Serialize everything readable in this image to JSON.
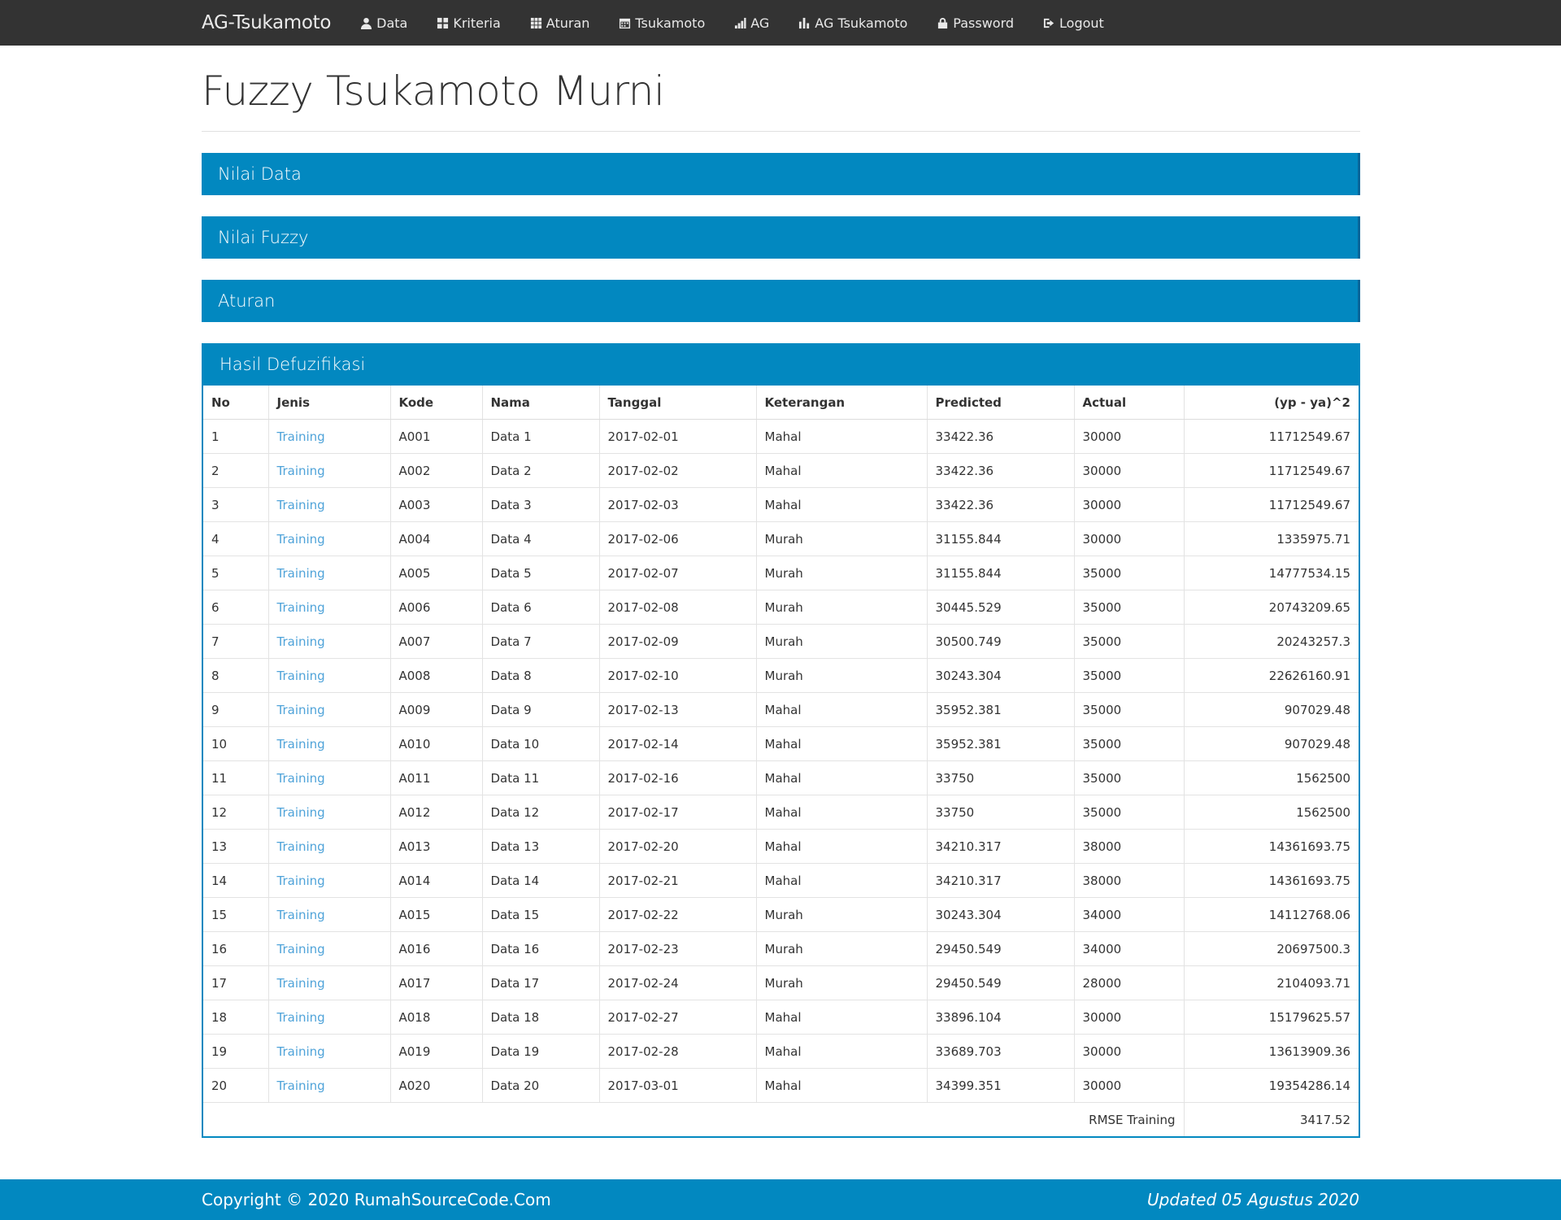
{
  "nav": {
    "brand": "AG-Tsukamoto",
    "items": [
      {
        "label": "Data",
        "icon": "user-icon"
      },
      {
        "label": "Kriteria",
        "icon": "grid-icon"
      },
      {
        "label": "Aturan",
        "icon": "th-icon"
      },
      {
        "label": "Tsukamoto",
        "icon": "calendar-icon"
      },
      {
        "label": "AG",
        "icon": "signal-icon"
      },
      {
        "label": "AG Tsukamoto",
        "icon": "stats-icon"
      },
      {
        "label": "Password",
        "icon": "lock-icon"
      },
      {
        "label": "Logout",
        "icon": "logout-icon"
      }
    ]
  },
  "page": {
    "title": "Fuzzy Tsukamoto Murni"
  },
  "panels": [
    {
      "title": "Nilai Data"
    },
    {
      "title": "Nilai Fuzzy"
    },
    {
      "title": "Aturan"
    }
  ],
  "result": {
    "title": "Hasil Defuzifikasi",
    "headers": [
      "No",
      "Jenis",
      "Kode",
      "Nama",
      "Tanggal",
      "Keterangan",
      "Predicted",
      "Actual",
      "(yp - ya)^2"
    ],
    "rows": [
      [
        "1",
        "Training",
        "A001",
        "Data 1",
        "2017-02-01",
        "Mahal",
        "33422.36",
        "30000",
        "11712549.67"
      ],
      [
        "2",
        "Training",
        "A002",
        "Data 2",
        "2017-02-02",
        "Mahal",
        "33422.36",
        "30000",
        "11712549.67"
      ],
      [
        "3",
        "Training",
        "A003",
        "Data 3",
        "2017-02-03",
        "Mahal",
        "33422.36",
        "30000",
        "11712549.67"
      ],
      [
        "4",
        "Training",
        "A004",
        "Data 4",
        "2017-02-06",
        "Murah",
        "31155.844",
        "30000",
        "1335975.71"
      ],
      [
        "5",
        "Training",
        "A005",
        "Data 5",
        "2017-02-07",
        "Murah",
        "31155.844",
        "35000",
        "14777534.15"
      ],
      [
        "6",
        "Training",
        "A006",
        "Data 6",
        "2017-02-08",
        "Murah",
        "30445.529",
        "35000",
        "20743209.65"
      ],
      [
        "7",
        "Training",
        "A007",
        "Data 7",
        "2017-02-09",
        "Murah",
        "30500.749",
        "35000",
        "20243257.3"
      ],
      [
        "8",
        "Training",
        "A008",
        "Data 8",
        "2017-02-10",
        "Murah",
        "30243.304",
        "35000",
        "22626160.91"
      ],
      [
        "9",
        "Training",
        "A009",
        "Data 9",
        "2017-02-13",
        "Mahal",
        "35952.381",
        "35000",
        "907029.48"
      ],
      [
        "10",
        "Training",
        "A010",
        "Data 10",
        "2017-02-14",
        "Mahal",
        "35952.381",
        "35000",
        "907029.48"
      ],
      [
        "11",
        "Training",
        "A011",
        "Data 11",
        "2017-02-16",
        "Mahal",
        "33750",
        "35000",
        "1562500"
      ],
      [
        "12",
        "Training",
        "A012",
        "Data 12",
        "2017-02-17",
        "Mahal",
        "33750",
        "35000",
        "1562500"
      ],
      [
        "13",
        "Training",
        "A013",
        "Data 13",
        "2017-02-20",
        "Mahal",
        "34210.317",
        "38000",
        "14361693.75"
      ],
      [
        "14",
        "Training",
        "A014",
        "Data 14",
        "2017-02-21",
        "Mahal",
        "34210.317",
        "38000",
        "14361693.75"
      ],
      [
        "15",
        "Training",
        "A015",
        "Data 15",
        "2017-02-22",
        "Murah",
        "30243.304",
        "34000",
        "14112768.06"
      ],
      [
        "16",
        "Training",
        "A016",
        "Data 16",
        "2017-02-23",
        "Murah",
        "29450.549",
        "34000",
        "20697500.3"
      ],
      [
        "17",
        "Training",
        "A017",
        "Data 17",
        "2017-02-24",
        "Murah",
        "29450.549",
        "28000",
        "2104093.71"
      ],
      [
        "18",
        "Training",
        "A018",
        "Data 18",
        "2017-02-27",
        "Mahal",
        "33896.104",
        "30000",
        "15179625.57"
      ],
      [
        "19",
        "Training",
        "A019",
        "Data 19",
        "2017-02-28",
        "Mahal",
        "33689.703",
        "30000",
        "13613909.36"
      ],
      [
        "20",
        "Training",
        "A020",
        "Data 20",
        "2017-03-01",
        "Mahal",
        "34399.351",
        "30000",
        "19354286.14"
      ]
    ],
    "rmse_label": "RMSE Training",
    "rmse_value": "3417.52"
  },
  "footer": {
    "copyright": "Copyright © 2020 RumahSourceCode.Com",
    "updated": "Updated 05 Agustus 2020"
  },
  "colors": {
    "navbar": "#333333",
    "accent": "#0288c0",
    "link": "#4fa3d9"
  }
}
